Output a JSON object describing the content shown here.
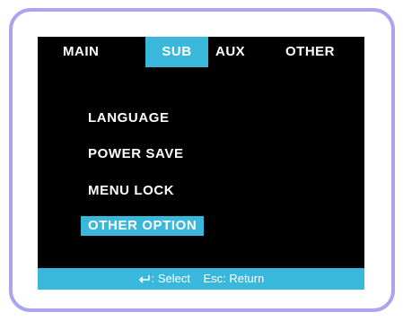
{
  "tabs": [
    {
      "label": "MAIN",
      "active": false
    },
    {
      "label": "SUB",
      "active": true
    },
    {
      "label": "AUX",
      "active": false
    },
    {
      "label": "OTHER",
      "active": false
    }
  ],
  "menu": {
    "items": [
      {
        "label": "LANGUAGE",
        "selected": false
      },
      {
        "label": "POWER SAVE",
        "selected": false
      },
      {
        "label": "MENU LOCK",
        "selected": false
      },
      {
        "label": "OTHER OPTION",
        "selected": true
      }
    ]
  },
  "status": {
    "enter_icon": "enter-icon",
    "select_text": ": Select",
    "return_text": "Esc: Return"
  },
  "colors": {
    "accent": "#39b8dc",
    "frame_border": "#a9a6ee",
    "screen_bg": "#000000",
    "text": "#ffffff"
  }
}
